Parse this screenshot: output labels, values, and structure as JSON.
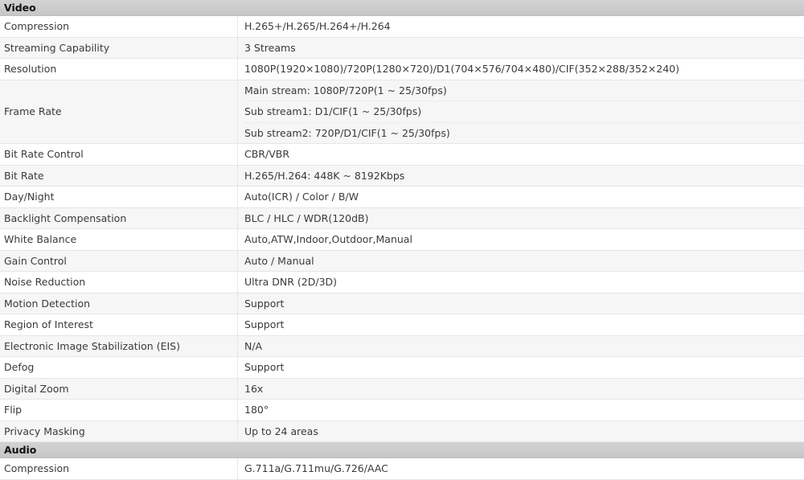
{
  "sections": [
    {
      "title": "Video",
      "rows": [
        {
          "label": "Compression",
          "values": [
            "H.265+/H.265/H.264+/H.264"
          ]
        },
        {
          "label": "Streaming Capability",
          "values": [
            "3 Streams"
          ]
        },
        {
          "label": "Resolution",
          "values": [
            "1080P(1920×1080)/720P(1280×720)/D1(704×576/704×480)/CIF(352×288/352×240)"
          ]
        },
        {
          "label": "Frame Rate",
          "values": [
            "Main stream: 1080P/720P(1 ~ 25/30fps)",
            "Sub stream1: D1/CIF(1 ~ 25/30fps)",
            "Sub stream2: 720P/D1/CIF(1 ~ 25/30fps)"
          ]
        },
        {
          "label": "Bit Rate Control",
          "values": [
            "CBR/VBR"
          ]
        },
        {
          "label": "Bit Rate",
          "values": [
            "H.265/H.264: 448K ~ 8192Kbps"
          ]
        },
        {
          "label": "Day/Night",
          "values": [
            "Auto(ICR) / Color / B/W"
          ]
        },
        {
          "label": "Backlight Compensation",
          "values": [
            "BLC / HLC / WDR(120dB)"
          ]
        },
        {
          "label": "White Balance",
          "values": [
            "Auto,ATW,Indoor,Outdoor,Manual"
          ]
        },
        {
          "label": "Gain Control",
          "values": [
            "Auto / Manual"
          ]
        },
        {
          "label": "Noise Reduction",
          "values": [
            "Ultra DNR (2D/3D)"
          ]
        },
        {
          "label": "Motion Detection",
          "values": [
            "Support"
          ]
        },
        {
          "label": "Region of Interest",
          "values": [
            "Support"
          ]
        },
        {
          "label": "Electronic Image Stabilization (EIS)",
          "values": [
            "N/A"
          ]
        },
        {
          "label": "Defog",
          "values": [
            "Support"
          ]
        },
        {
          "label": "Digital Zoom",
          "values": [
            "16x"
          ]
        },
        {
          "label": "Flip",
          "values": [
            "180°"
          ]
        },
        {
          "label": "Privacy Masking",
          "values": [
            "Up to 24 areas"
          ]
        }
      ]
    },
    {
      "title": "Audio",
      "rows": [
        {
          "label": "Compression",
          "values": [
            "G.711a/G.711mu/G.726/AAC"
          ]
        }
      ]
    }
  ]
}
